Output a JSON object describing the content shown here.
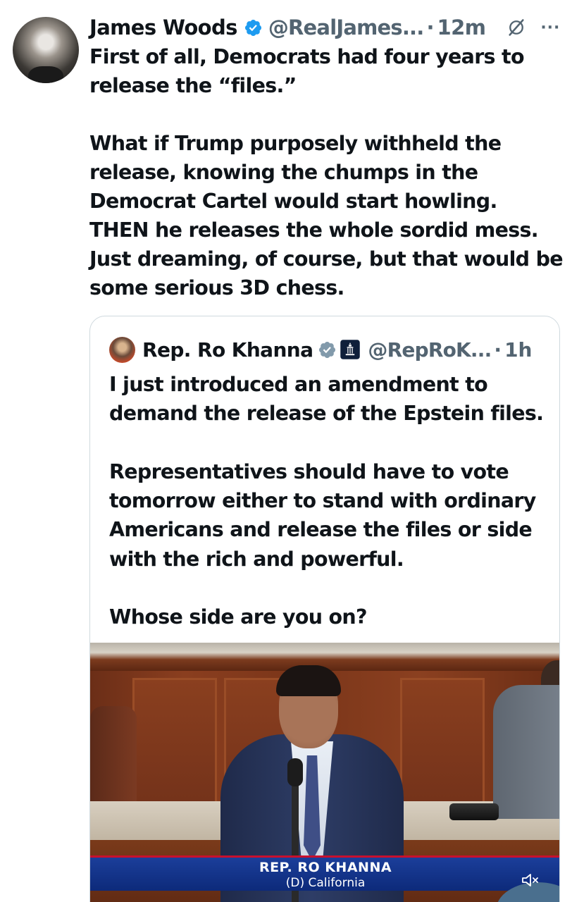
{
  "tweet": {
    "author_name": "James Woods",
    "handle": "@RealJames...",
    "separator": "·",
    "time": "12m",
    "more": "···",
    "text": "First of all, Democrats had four years to\nrelease the “files.”\n\nWhat if Trump purposely withheld the\nrelease, knowing the chumps in the\nDemocrat Cartel would start howling.\nTHEN he releases the whole sordid mess.\nJust dreaming, of course, but that would be\nsome serious 3D chess."
  },
  "quote": {
    "author_name": "Rep. Ro Khanna",
    "handle": "@RepRoK...",
    "separator": "·",
    "time": "1h",
    "text": "I just introduced an amendment to\ndemand the release of the Epstein files.\n\nRepresentatives should have to vote\ntomorrow either to stand with ordinary\nAmericans and release the files or side\nwith the rich and powerful.\n\nWhose side are you on?",
    "video": {
      "lower_third_name": "REP. RO KHANNA",
      "lower_third_sub": "(D) California"
    }
  },
  "colors": {
    "verified": "#1d9bf0",
    "verified_gray": "#829aab",
    "secondary_text": "#536471",
    "border": "#cfd9de"
  },
  "icons": {
    "verified": "verified-badge-icon",
    "grok": "grok-icon",
    "more": "more-icon",
    "government": "government-badge-icon",
    "mute": "mute-icon"
  }
}
